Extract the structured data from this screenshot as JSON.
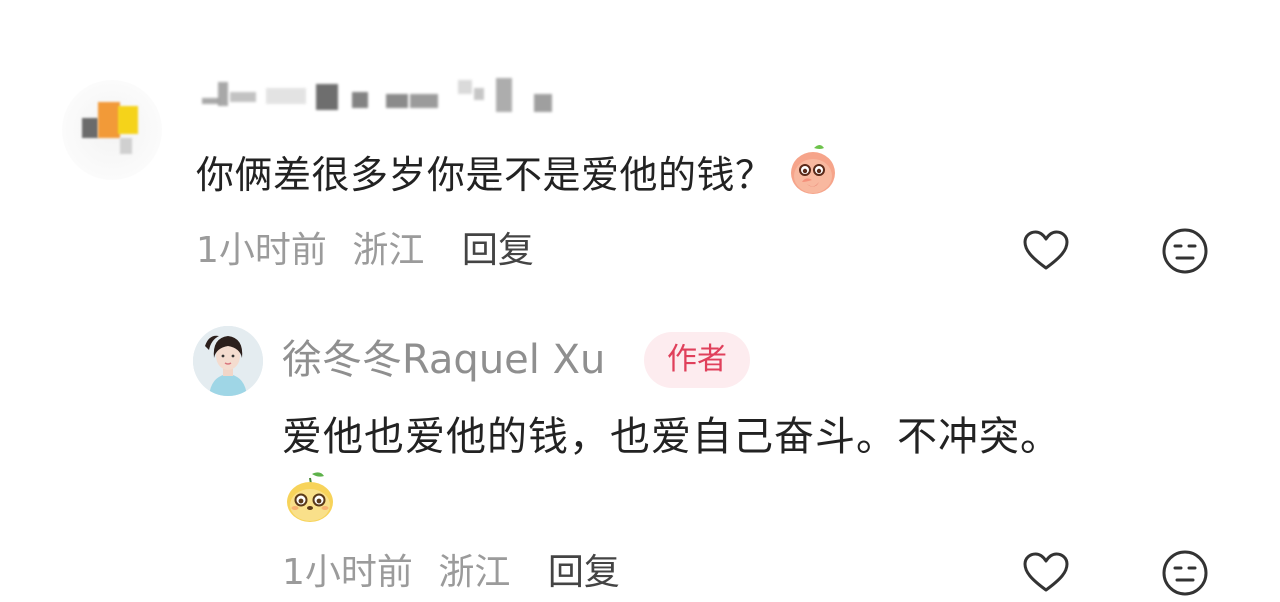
{
  "comment": {
    "username": "",
    "text": "你俩差很多岁你是不是爱他的钱？",
    "inline_emoji": "shy-peach-emoji",
    "time": "1小时前",
    "location": "浙江",
    "reply_label": "回复"
  },
  "reply": {
    "username": "徐冬冬Raquel Xu",
    "badge": "作者",
    "text": "爱他也爱他的钱，也爱自己奋斗。不冲突。",
    "emoji": "smiling-mango-emoji",
    "time": "1小时前",
    "location": "浙江",
    "reply_label": "回复"
  },
  "icons": {
    "like": "heart-outline-icon",
    "dislike": "meh-face-icon"
  },
  "colors": {
    "meta_gray": "#9b9b9b",
    "badge_bg": "#fdecef",
    "badge_text": "#e0405b"
  }
}
